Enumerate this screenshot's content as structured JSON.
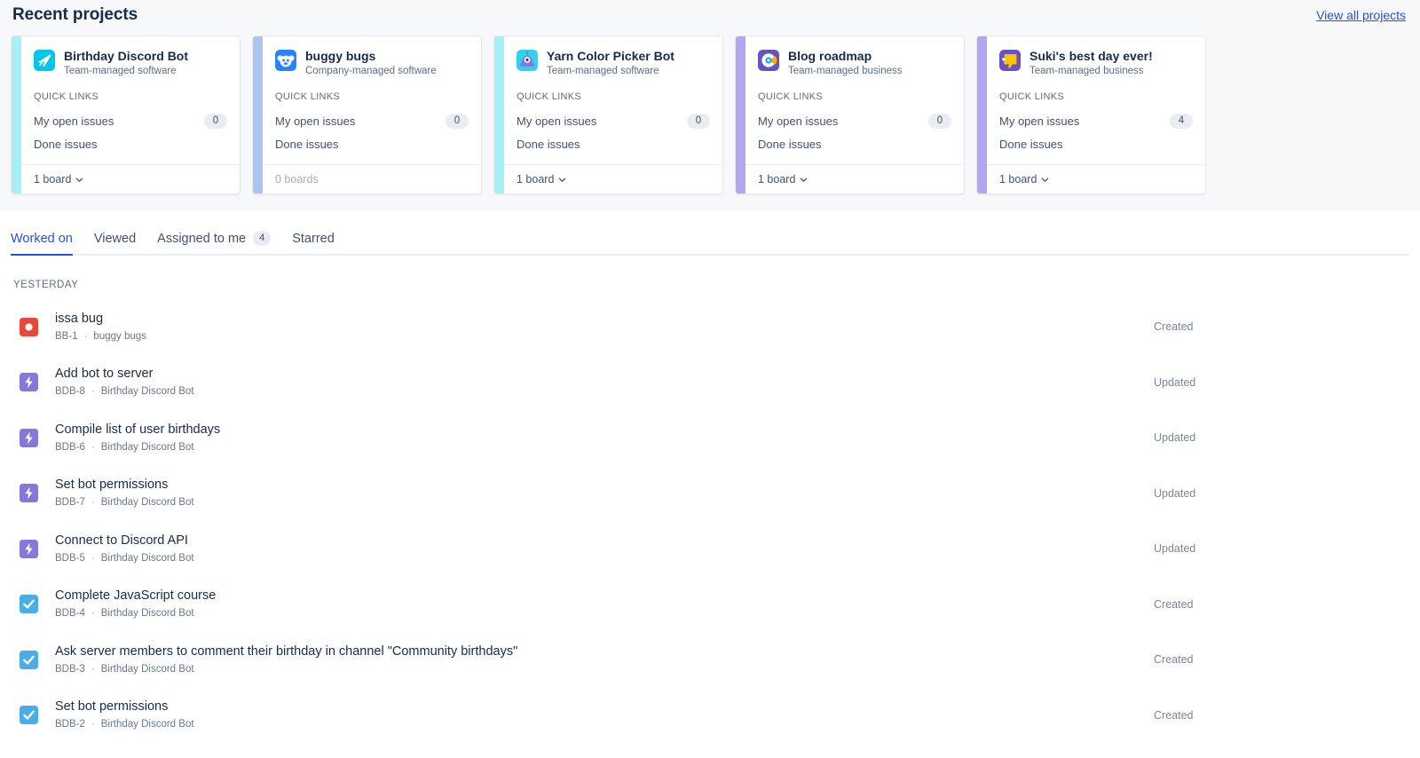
{
  "recent": {
    "title": "Recent projects",
    "view_all_label": "View all projects",
    "quick_links_label": "QUICK LINKS",
    "projects": [
      {
        "name": "Birthday Discord Bot",
        "type": "Team-managed software",
        "stripe_color": "#A5F0F7",
        "avatar_icon": "airplane-icon",
        "avatar_bg": "#00C7E6",
        "links": [
          {
            "label": "My open issues",
            "count": "0"
          },
          {
            "label": "Done issues",
            "count": null
          }
        ],
        "boards_label": "1 board",
        "boards_muted": false
      },
      {
        "name": "buggy bugs",
        "type": "Company-managed software",
        "stripe_color": "#A8C6F0",
        "avatar_icon": "koala-icon",
        "avatar_bg": "#2684FF",
        "links": [
          {
            "label": "My open issues",
            "count": "0"
          },
          {
            "label": "Done issues",
            "count": null
          }
        ],
        "boards_label": "0 boards",
        "boards_muted": true
      },
      {
        "name": "Yarn Color Picker Bot",
        "type": "Team-managed software",
        "stripe_color": "#A5F0F7",
        "avatar_icon": "robot-icon",
        "avatar_bg": "#2BD4E8",
        "links": [
          {
            "label": "My open issues",
            "count": "0"
          },
          {
            "label": "Done issues",
            "count": null
          }
        ],
        "boards_label": "1 board",
        "boards_muted": false
      },
      {
        "name": "Blog roadmap",
        "type": "Team-managed business",
        "stripe_color": "#B3A6F0",
        "avatar_icon": "pacman-circle-icon",
        "avatar_bg": "#6554C0",
        "links": [
          {
            "label": "My open issues",
            "count": "0"
          },
          {
            "label": "Done issues",
            "count": null
          }
        ],
        "boards_label": "1 board",
        "boards_muted": false
      },
      {
        "name": "Suki's best day ever!",
        "type": "Team-managed business",
        "stripe_color": "#B3A6F0",
        "avatar_icon": "thumbs-down-icon",
        "avatar_bg": "#6554C0",
        "links": [
          {
            "label": "My open issues",
            "count": "4"
          },
          {
            "label": "Done issues",
            "count": null
          }
        ],
        "boards_label": "1 board",
        "boards_muted": false
      }
    ]
  },
  "tabs": [
    {
      "label": "Worked on",
      "badge": null,
      "active": true
    },
    {
      "label": "Viewed",
      "badge": null,
      "active": false
    },
    {
      "label": "Assigned to me",
      "badge": "4",
      "active": false
    },
    {
      "label": "Starred",
      "badge": null,
      "active": false
    }
  ],
  "activity": {
    "day_label": "YESTERDAY",
    "separator": "·",
    "rows": [
      {
        "title": "issa bug",
        "key": "BB-1",
        "project": "buggy bugs",
        "action": "Created",
        "icon": "bug-icon",
        "icon_color": "#E5493A"
      },
      {
        "title": "Add bot to server",
        "key": "BDB-8",
        "project": "Birthday Discord Bot",
        "action": "Updated",
        "icon": "task-bolt-icon",
        "icon_color": "#8777D9"
      },
      {
        "title": "Compile list of user birthdays",
        "key": "BDB-6",
        "project": "Birthday Discord Bot",
        "action": "Updated",
        "icon": "task-bolt-icon",
        "icon_color": "#8777D9"
      },
      {
        "title": "Set bot permissions",
        "key": "BDB-7",
        "project": "Birthday Discord Bot",
        "action": "Updated",
        "icon": "task-bolt-icon",
        "icon_color": "#8777D9"
      },
      {
        "title": "Connect to Discord API",
        "key": "BDB-5",
        "project": "Birthday Discord Bot",
        "action": "Updated",
        "icon": "task-bolt-icon",
        "icon_color": "#8777D9"
      },
      {
        "title": "Complete JavaScript course",
        "key": "BDB-4",
        "project": "Birthday Discord Bot",
        "action": "Created",
        "icon": "task-check-icon",
        "icon_color": "#4BADE8"
      },
      {
        "title": "Ask server members to comment their birthday in channel \"Community birthdays\"",
        "key": "BDB-3",
        "project": "Birthday Discord Bot",
        "action": "Created",
        "icon": "task-check-icon",
        "icon_color": "#4BADE8"
      },
      {
        "title": "Set bot permissions",
        "key": "BDB-2",
        "project": "Birthday Discord Bot",
        "action": "Created",
        "icon": "task-check-icon",
        "icon_color": "#4BADE8"
      }
    ]
  }
}
